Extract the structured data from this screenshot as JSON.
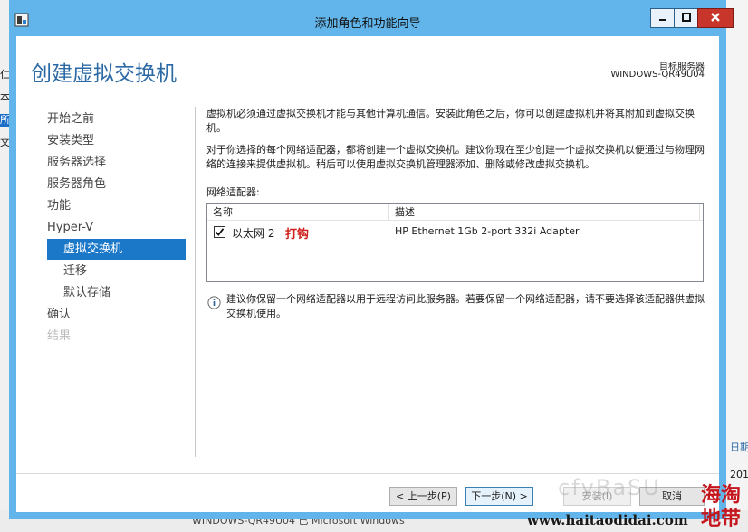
{
  "window": {
    "title": "添加角色和功能向导",
    "page_title": "创建虚拟交换机",
    "target_label": "目标服务器",
    "target_server": "WINDOWS-QR49U04"
  },
  "nav": {
    "items": [
      {
        "label": "开始之前",
        "state": "normal"
      },
      {
        "label": "安装类型",
        "state": "normal"
      },
      {
        "label": "服务器选择",
        "state": "normal"
      },
      {
        "label": "服务器角色",
        "state": "normal"
      },
      {
        "label": "功能",
        "state": "normal"
      },
      {
        "label": "Hyper-V",
        "state": "normal"
      },
      {
        "label": "虚拟交换机",
        "state": "active"
      },
      {
        "label": "迁移",
        "state": "normal"
      },
      {
        "label": "默认存储",
        "state": "normal"
      },
      {
        "label": "确认",
        "state": "normal"
      },
      {
        "label": "结果",
        "state": "disabled"
      }
    ]
  },
  "main": {
    "para1": "虚拟机必须通过虚拟交换机才能与其他计算机通信。安装此角色之后，你可以创建虚拟机并将其附加到虚拟交换机。",
    "para2": "对于你选择的每个网络适配器，都将创建一个虚拟交换机。建议你现在至少创建一个虚拟交换机以便通过与物理网络的连接来提供虚拟机。稍后可以使用虚拟交换机管理器添加、删除或修改虚拟交换机。",
    "adapters_label": "网络适配器:",
    "table": {
      "col_name": "名称",
      "col_desc": "描述",
      "rows": [
        {
          "name": "以太网 2",
          "annotation": "打钩",
          "desc": "HP Ethernet 1Gb 2-port 332i Adapter",
          "checked": true
        }
      ]
    },
    "info": "建议你保留一个网络适配器以用于远程访问此服务器。若要保留一个网络适配器，请不要选择该适配器供虚拟交换机使用。"
  },
  "buttons": {
    "prev": "< 上一步(P)",
    "next": "下一步(N) >",
    "install": "安装(I)",
    "cancel": "取消"
  },
  "background": {
    "right_label": "日期",
    "right_num1": "201",
    "right_num2": "201",
    "bottom_row": "WINDOWS-QR49U04   已     Microsoft Windows"
  },
  "watermark": {
    "url": "www.haitaodidai.com",
    "seal": "海淘地带"
  },
  "colors": {
    "window_chrome": "#62b5ea",
    "accent_title": "#2c6aa6",
    "nav_active": "#1b78c8",
    "annotation_red": "#d0201c",
    "close_button": "#c7352b"
  }
}
